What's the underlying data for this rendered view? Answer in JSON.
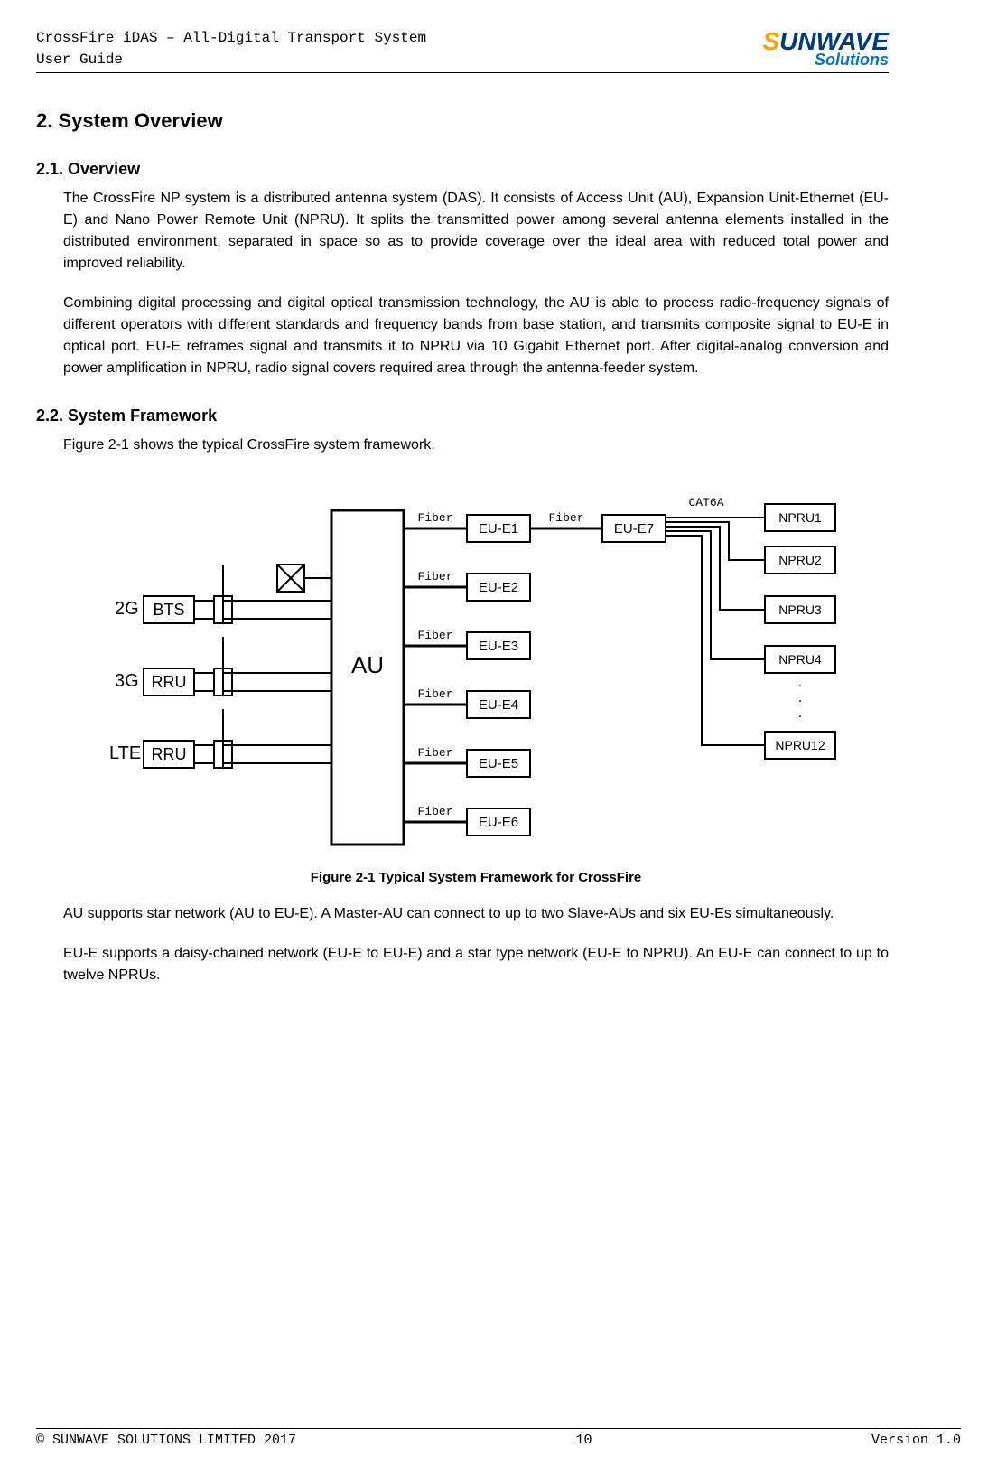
{
  "header": {
    "line1": "CrossFire iDAS – All-Digital Transport System",
    "line2": "User Guide",
    "logo_main_a": "S",
    "logo_main_b": "UNWAVE",
    "logo_sub": "Solutions"
  },
  "section": {
    "h1": "2.  System Overview",
    "s21_title": "2.1. Overview",
    "p1": "The CrossFire NP system is a distributed antenna system (DAS). It consists of Access Unit (AU), Expansion Unit-Ethernet (EU-E) and Nano Power Remote Unit (NPRU). It splits the transmitted power among several antenna elements installed in the distributed environment, separated in space so as to provide coverage over the ideal area with reduced total power and improved reliability.",
    "p2": "Combining digital processing and digital optical transmission technology, the AU is able to process radio-frequency signals of different operators with different standards and frequency bands from base station, and transmits composite signal to EU-E in optical port. EU-E reframes signal and transmits it to NPRU via 10 Gigabit Ethernet port. After digital-analog conversion and power amplification in NPRU, radio signal covers required area through the antenna-feeder system.",
    "s22_title": "2.2. System Framework",
    "p3": "Figure 2-1 shows the typical CrossFire system framework.",
    "caption": "Figure 2-1 Typical System Framework for CrossFire",
    "p4": "AU supports star network (AU to EU-E). A Master-AU can connect to up to two Slave-AUs and six EU-Es simultaneously.",
    "p5": "EU-E supports a daisy-chained network (EU-E to EU-E) and a star type network (EU-E to NPRU). An EU-E can connect to up to twelve NPRUs."
  },
  "diagram": {
    "inputs": [
      "2G",
      "3G",
      "LTE"
    ],
    "input_boxes": [
      "BTS",
      "RRU",
      "RRU"
    ],
    "au": "AU",
    "fiber_label": "Fiber",
    "cat6a_label": "CAT6A",
    "eu": [
      "EU-E1",
      "EU-E2",
      "EU-E3",
      "EU-E4",
      "EU-E5",
      "EU-E6",
      "EU-E7"
    ],
    "npru": [
      "NPRU1",
      "NPRU2",
      "NPRU3",
      "NPRU4",
      "NPRU12"
    ],
    "dots": ". . ."
  },
  "footer": {
    "left": "© SUNWAVE SOLUTIONS LIMITED 2017",
    "center": "10",
    "right": "Version 1.0"
  }
}
